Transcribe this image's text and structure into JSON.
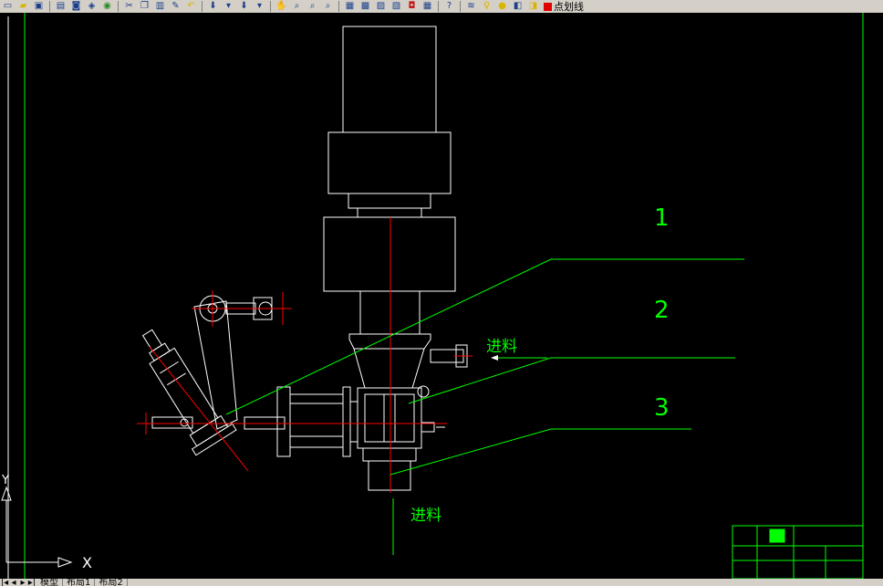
{
  "toolbar": {
    "linetype_label": "点划线",
    "active_color": "#e00000",
    "icons": [
      "new-file-icon",
      "open-folder-icon",
      "save-icon",
      "print-icon",
      "print-preview-icon",
      "publish-icon",
      "plot-icon",
      "cut-icon",
      "copy-icon",
      "paste-icon",
      "match-properties-icon",
      "undo-icon",
      "redo-icon",
      "pan-icon",
      "zoom-realtime-icon",
      "zoom-window-icon",
      "zoom-previous-icon",
      "properties-icon",
      "design-center-icon",
      "tool-palettes-icon",
      "sheet-set-icon",
      "markup-icon",
      "calculator-icon",
      "help-icon",
      "layer-manager-icon",
      "layer-on-icon",
      "layer-freeze-icon",
      "layer-lock-icon",
      "layer-color-icon"
    ]
  },
  "drawing": {
    "labels": {
      "callout_1": "1",
      "callout_2": "2",
      "callout_3": "3",
      "feed_upper": "进料",
      "feed_lower": "进料"
    },
    "ucs": {
      "x_label": "X",
      "y_label": "Y"
    },
    "colors": {
      "background": "#000000",
      "geometry": "#ffffff",
      "leader": "#00ff00",
      "centerline": "#ff0000"
    }
  },
  "layout_tabs": {
    "tabs": [
      "模型",
      "布局1",
      "布局2"
    ],
    "active": "模型"
  }
}
